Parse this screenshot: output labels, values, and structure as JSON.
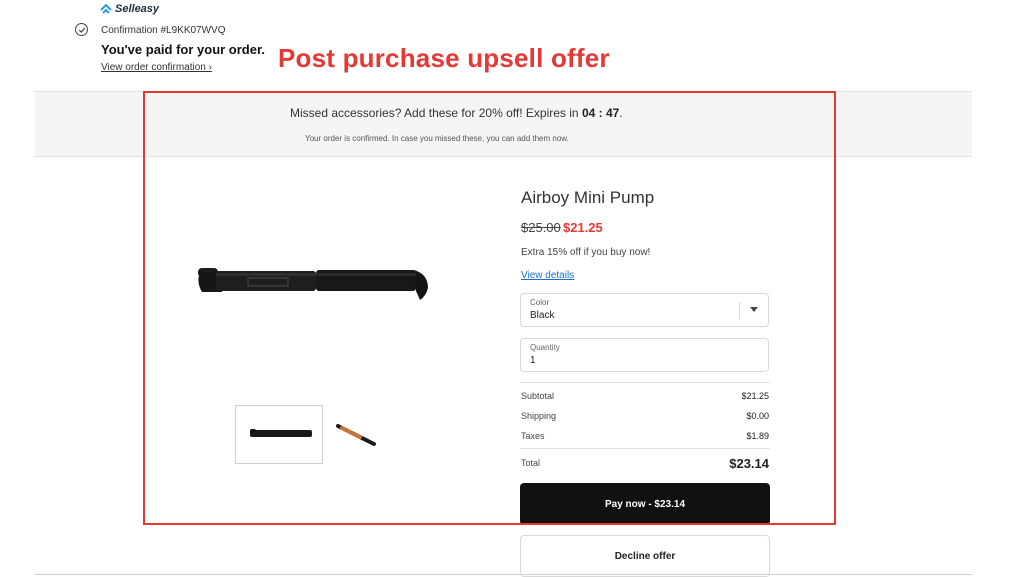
{
  "brand": {
    "name": "Selleasy",
    "logo_icon": "chevron-up-icon",
    "logo_color": "#2a9fd8"
  },
  "header": {
    "confirmation": "Confirmation #L9KK07WVQ",
    "paid_message": "You've paid for your order.",
    "view_confirmation": "View order confirmation ›"
  },
  "annotation": {
    "headline": "Post purchase upsell offer",
    "color": "#e53935"
  },
  "banner": {
    "main_text": "Missed accessories? Add these for 20% off! Expires in",
    "timer": "04 : 47",
    "main_suffix": ".",
    "sub_text": "Your order is confirmed. In case you missed these, you can add them now."
  },
  "product": {
    "name": "Airboy Mini Pump",
    "original_price": "$25.00",
    "sale_price": "$21.25",
    "promo": "Extra 15% off if you buy now!",
    "view_details": "View details",
    "color_label": "Color",
    "color_value": "Black",
    "quantity_label": "Quantity",
    "quantity_value": "1"
  },
  "summary": {
    "subtotal_label": "Subtotal",
    "subtotal": "$21.25",
    "shipping_label": "Shipping",
    "shipping": "$0.00",
    "taxes_label": "Taxes",
    "taxes": "$1.89",
    "total_label": "Total",
    "total": "$23.14"
  },
  "actions": {
    "pay": "Pay now - $23.14",
    "decline": "Decline offer"
  }
}
